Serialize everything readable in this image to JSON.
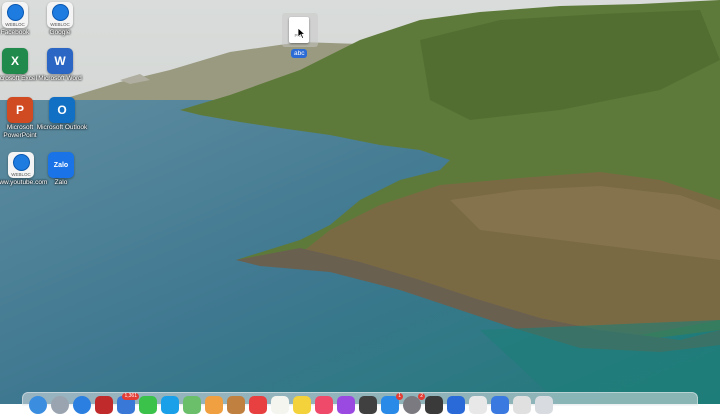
{
  "desktop": {
    "icons": [
      {
        "label": "Facebook",
        "kind": "webloc",
        "tag": "WEBLOC",
        "icon": "compass-icon"
      },
      {
        "label": "Google",
        "kind": "webloc",
        "tag": "WEBLOC",
        "icon": "compass-icon"
      },
      {
        "label": "Microsoft Excel",
        "kind": "excel",
        "glyph": "X",
        "icon": "excel-icon"
      },
      {
        "label": "Microsoft Word",
        "kind": "word",
        "glyph": "W",
        "icon": "word-icon"
      },
      {
        "label": "Microsoft PowerPoint",
        "kind": "ppt",
        "glyph": "P",
        "icon": "powerpoint-icon"
      },
      {
        "label": "Microsoft Outlook",
        "kind": "outlook",
        "glyph": "O",
        "icon": "outlook-icon"
      },
      {
        "label": "www.youtube.com",
        "kind": "webloc",
        "tag": "WEBLOC",
        "icon": "compass-icon"
      },
      {
        "label": "Zalo",
        "kind": "zalo",
        "glyph": "Zalo",
        "icon": "zalo-icon"
      }
    ],
    "dragged_file": {
      "label": "abc",
      "type": "PDF"
    }
  },
  "dock": {
    "items": [
      {
        "name": "finder",
        "color": "#3b8de0"
      },
      {
        "name": "launchpad",
        "color": "#9aa4b0"
      },
      {
        "name": "safari",
        "color": "#2a7fe0"
      },
      {
        "name": "app",
        "color": "#c02a2a"
      },
      {
        "name": "mail",
        "color": "#3a78d8",
        "badge": "1,361"
      },
      {
        "name": "messages",
        "color": "#3bc24a"
      },
      {
        "name": "app",
        "color": "#1aa0e8"
      },
      {
        "name": "maps",
        "color": "#6bbf6a"
      },
      {
        "name": "photos",
        "color": "#f0a040"
      },
      {
        "name": "app",
        "color": "#c08040"
      },
      {
        "name": "app",
        "color": "#e84040"
      },
      {
        "name": "notes",
        "color": "#f5f5f0"
      },
      {
        "name": "notes",
        "color": "#f4d23c"
      },
      {
        "name": "music",
        "color": "#f04a6a"
      },
      {
        "name": "app",
        "color": "#9a4ae0"
      },
      {
        "name": "app",
        "color": "#404040"
      },
      {
        "name": "app-store",
        "color": "#2a8ae8",
        "badge": "1"
      },
      {
        "name": "settings",
        "color": "#7a7a80",
        "badge": "2"
      },
      {
        "name": "app",
        "color": "#3a3a3a"
      },
      {
        "name": "app",
        "color": "#2a6ad8"
      },
      {
        "name": "app",
        "color": "#e8e8e8"
      },
      {
        "name": "app",
        "color": "#3a7ae0"
      },
      {
        "name": "app",
        "color": "#e0e0e0"
      },
      {
        "name": "trash",
        "color": "#d8dce0"
      }
    ]
  }
}
